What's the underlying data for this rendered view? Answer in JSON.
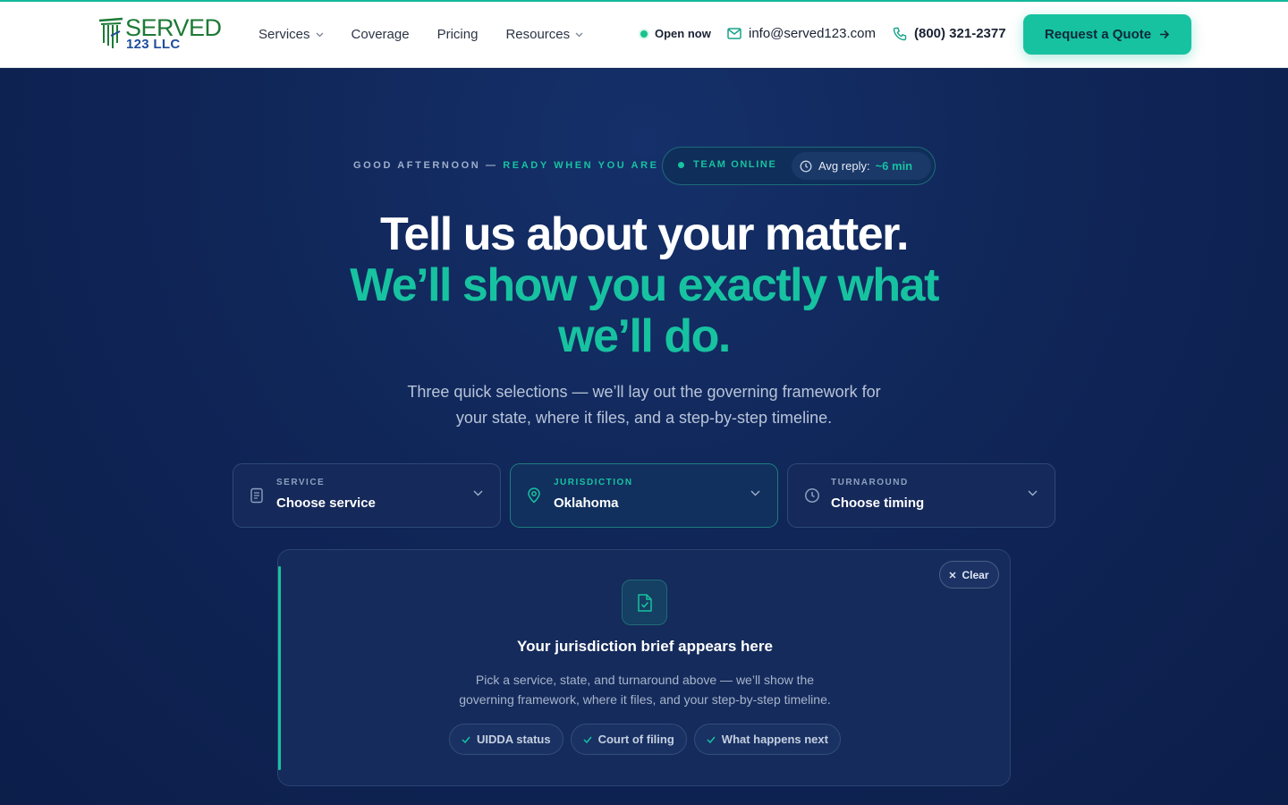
{
  "brand": {
    "name": "SERVED",
    "suffix": "123 LLC"
  },
  "nav": {
    "items": [
      {
        "label": "Services",
        "dropdown": true
      },
      {
        "label": "Coverage",
        "dropdown": false
      },
      {
        "label": "Pricing",
        "dropdown": false
      },
      {
        "label": "Resources",
        "dropdown": true
      }
    ]
  },
  "header": {
    "status": "Open now",
    "email": "info@served123.com",
    "phone": "(800) 321-2377",
    "cta": "Request a Quote"
  },
  "hero": {
    "greeting_lead": "GOOD AFTERNOON —",
    "greeting_accent": "READY WHEN YOU ARE",
    "team_status": "TEAM ONLINE",
    "avg_reply_label": "Avg reply:",
    "avg_reply_value": "~6 min",
    "headline_line1": "Tell us about your matter.",
    "headline_line2": "We’ll show you exactly what",
    "headline_line3": "we’ll do.",
    "subtext_line1": "Three quick selections — we’ll lay out the governing framework for",
    "subtext_line2": "your state, where it files, and a step-by-step timeline."
  },
  "selectors": [
    {
      "label": "SERVICE",
      "value": "Choose service",
      "icon": "document-icon"
    },
    {
      "label": "JURISDICTION",
      "value": "Oklahoma",
      "icon": "map-pin-icon"
    },
    {
      "label": "TURNAROUND",
      "value": "Choose timing",
      "icon": "clock-icon"
    }
  ],
  "brief": {
    "clear_label": "Clear",
    "title": "Your jurisdiction brief appears here",
    "text_line1": "Pick a service, state, and turnaround above — we’ll show the",
    "text_line2": "governing framework, where it files, and your step-by-step timeline.",
    "chips": [
      "UIDDA status",
      "Court of filing",
      "What happens next"
    ]
  },
  "colors": {
    "accent": "#17c2a0",
    "navy": "#102658",
    "logo_green": "#1c7a35",
    "logo_blue": "#1e4d9b"
  }
}
